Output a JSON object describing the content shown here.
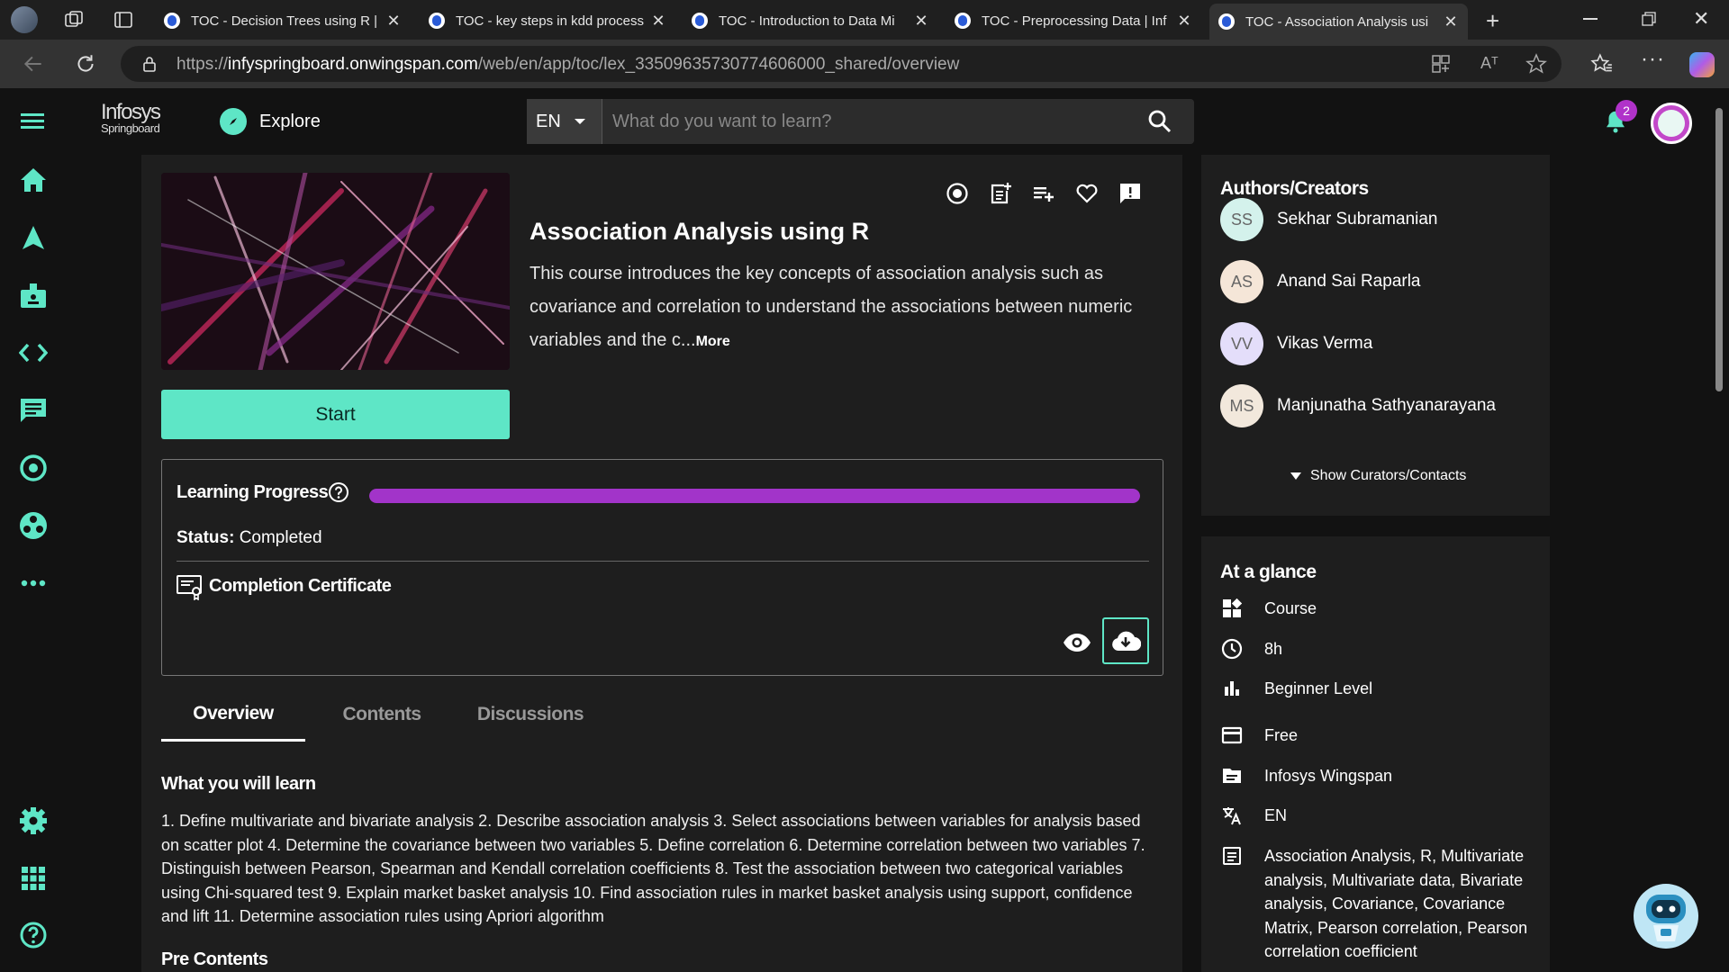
{
  "browser": {
    "tabs": [
      {
        "title": "TOC - Decision Trees using R |"
      },
      {
        "title": "TOC - key steps in kdd process"
      },
      {
        "title": "TOC - Introduction to Data Mi"
      },
      {
        "title": "TOC - Preprocessing Data | Inf"
      },
      {
        "title": "TOC - Association Analysis usi"
      }
    ],
    "url_prefix": "https://",
    "url_domain": "infyspringboard.onwingspan.com",
    "url_path": "/web/en/app/toc/lex_33509635730774606000_shared/overview",
    "read_aloud": "Aᵀ"
  },
  "header": {
    "logo_line1": "Infosys",
    "logo_line2": "Springboard",
    "explore_label": "Explore",
    "language": "EN",
    "search_placeholder": "What do you want to learn?",
    "notification_count": "2"
  },
  "course": {
    "title": "Association Analysis using R",
    "description": "This course introduces the key concepts of association analysis such as covariance and correlation to understand the associations between numeric variables and the c...",
    "more_label": "More",
    "start_label": "Start"
  },
  "progress": {
    "label": "Learning Progress",
    "percent": 100,
    "status_label": "Status:",
    "status_value": "Completed",
    "certificate_label": "Completion Certificate"
  },
  "tabs": [
    {
      "label": "Overview"
    },
    {
      "label": "Contents"
    },
    {
      "label": "Discussions"
    }
  ],
  "overview": {
    "learn_title": "What you will learn",
    "learn_text": "1. Define multivariate and bivariate analysis 2. Describe association analysis 3. Select associations between variables for analysis based on scatter plot 4. Determine the covariance between two variables 5. Define correlation 6. Determine correlation between two variables 7. Distinguish between Pearson, Spearman and Kendall correlation coefficients 8. Test the association between two categorical variables using Chi-squared test 9. Explain market basket analysis 10. Find association rules in market basket analysis using support, confidence and lift 11. Determine association rules using Apriori algorithm",
    "pre_title": "Pre Contents"
  },
  "authors": {
    "title": "Authors/Creators",
    "items": [
      {
        "initials": "SS",
        "name": "Sekhar Subramanian",
        "color": "#d4f2ec"
      },
      {
        "initials": "AS",
        "name": "Anand Sai Raparla",
        "color": "#f5e6d8"
      },
      {
        "initials": "VV",
        "name": "Vikas Verma",
        "color": "#e4defa"
      },
      {
        "initials": "MS",
        "name": "Manjunatha Sathyanarayana",
        "color": "#f2e8dc"
      }
    ],
    "curators_label": "Show Curators/Contacts"
  },
  "glance": {
    "title": "At a glance",
    "items": [
      {
        "icon": "category-icon",
        "text": "Course"
      },
      {
        "icon": "clock-icon",
        "text": "8h"
      },
      {
        "icon": "level-icon",
        "text": "Beginner Level"
      },
      {
        "icon": "card-icon",
        "text": "Free"
      },
      {
        "icon": "folder-icon",
        "text": "Infosys Wingspan"
      },
      {
        "icon": "translate-icon",
        "text": "EN"
      },
      {
        "icon": "tags-icon",
        "text": "Association Analysis, R, Multivariate analysis, Multivariate data, Bivariate analysis, Covariance, Covariance Matrix, Pearson correlation, Pearson correlation coefficient"
      }
    ]
  },
  "colors": {
    "accent": "#5ee6c6",
    "progress": "#a234c9",
    "background": "#121212",
    "card": "#1e1e1e"
  }
}
